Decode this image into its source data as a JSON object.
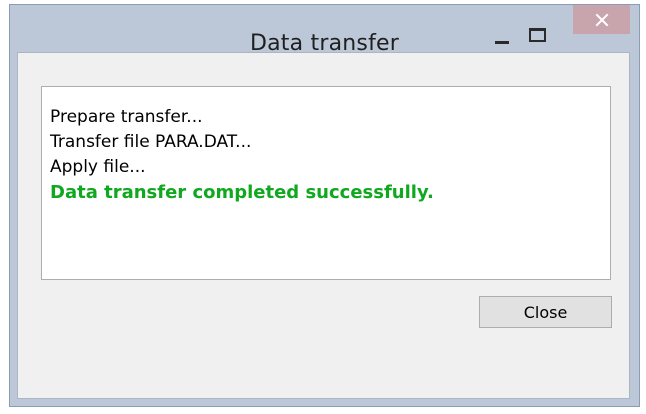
{
  "window": {
    "title": "Data transfer",
    "controls": {
      "minimize_icon": "minimize-icon",
      "maximize_icon": "maximize-icon",
      "close_icon": "close-icon"
    }
  },
  "log": {
    "lines": [
      "Prepare transfer...",
      "Transfer file PARA.DAT...",
      "Apply file..."
    ],
    "result": "Data transfer completed successfully."
  },
  "buttons": {
    "close_label": "Close"
  },
  "colors": {
    "frame": "#bcc8d8",
    "client_background": "#f0f0f0",
    "success_text": "#10a81e",
    "close_button_hover": "#c8a4ad"
  }
}
